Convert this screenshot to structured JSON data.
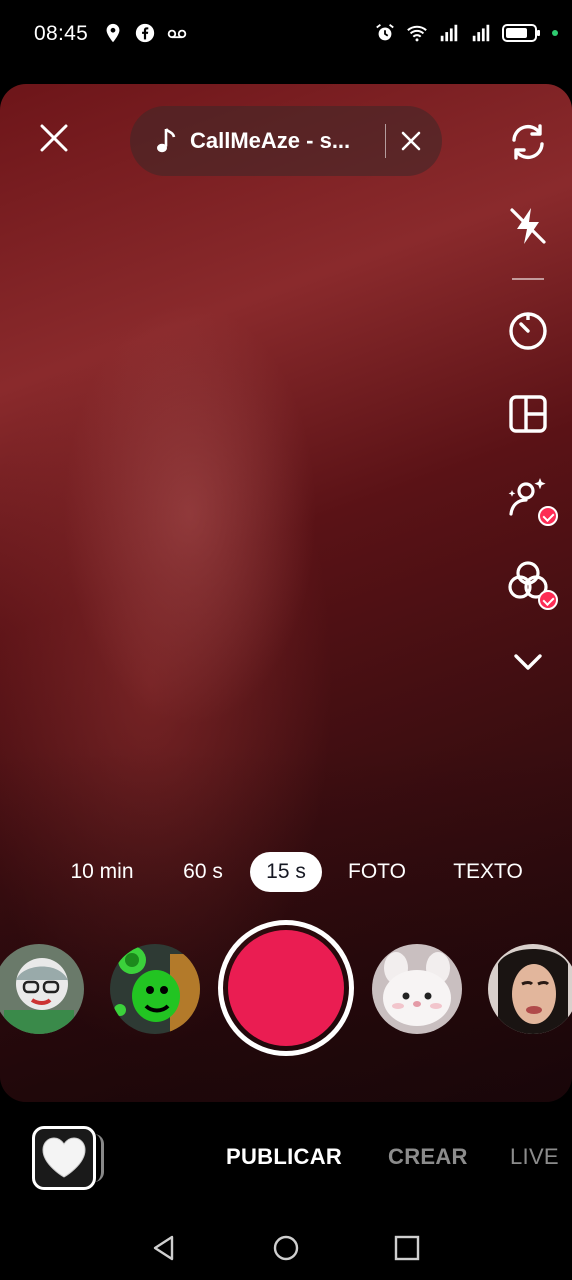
{
  "status_bar": {
    "time": "08:45",
    "left_icons": [
      "location-pin-icon",
      "facebook-icon",
      "voicemail-icon"
    ],
    "right_icons": [
      "alarm-icon",
      "wifi-icon",
      "signal-icon",
      "signal-icon-2",
      "battery-icon"
    ]
  },
  "top": {
    "close_icon": "close-icon",
    "sound_title": "CallMeAze - s...",
    "sound_icon": "music-note-icon",
    "sound_remove_icon": "close-icon"
  },
  "side_tools": [
    {
      "name": "flip-camera",
      "icon": "flip-camera-icon"
    },
    {
      "name": "flash",
      "icon": "flash-off-icon"
    },
    {
      "name": "timer",
      "icon": "timer-icon"
    },
    {
      "name": "layout",
      "icon": "layout-icon"
    },
    {
      "name": "beauty",
      "icon": "beauty-icon",
      "badge": true
    },
    {
      "name": "filters",
      "icon": "filters-icon",
      "badge": true
    },
    {
      "name": "more",
      "icon": "chevron-down-icon"
    }
  ],
  "durations": [
    {
      "label": "10 min",
      "active": false
    },
    {
      "label": "60 s",
      "active": false
    },
    {
      "label": "15 s",
      "active": true
    },
    {
      "label": "FOTO",
      "active": false
    },
    {
      "label": "TEXTO",
      "active": false
    }
  ],
  "bottom_tabs": [
    {
      "label": "PUBLICAR",
      "active": true
    },
    {
      "label": "CREAR",
      "active": false
    },
    {
      "label": "LIVE",
      "active": false
    }
  ],
  "colors": {
    "record": "#ea1d52",
    "badge": "#fe2c55"
  },
  "nav_icons": [
    "back-icon",
    "home-icon",
    "recents-icon"
  ]
}
